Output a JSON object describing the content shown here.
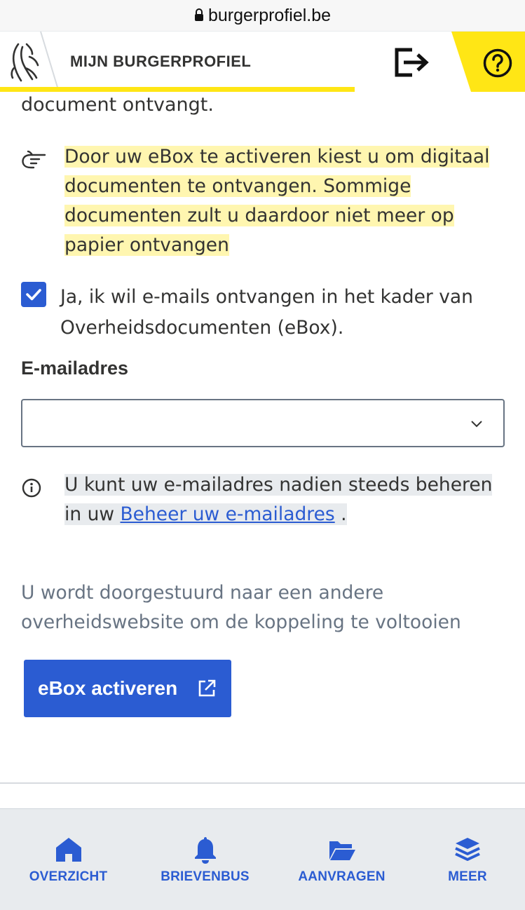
{
  "browser": {
    "url": "burgerprofiel.be"
  },
  "header": {
    "title": "MIJN BURGERPROFIEL",
    "accent_color": "#ffe615"
  },
  "content": {
    "paragraph_end": "document ontvangt.",
    "callout_text": "Door uw eBox te activeren kiest u om digitaal documenten te ontvangen. Sommige documenten zult u daardoor niet meer op papier ontvangen",
    "checkbox": {
      "checked": true,
      "label": "Ja, ik wil e-mails ontvangen in het kader van Overheidsdocumenten (eBox)."
    },
    "email": {
      "label": "E-mailadres",
      "value": ""
    },
    "info": {
      "text_before": "U kunt uw e-mailadres nadien steeds beheren in uw ",
      "link": "Beheer uw e-mailadres",
      "text_after": " ."
    },
    "redirect_text": "U wordt doorgestuurd naar een andere overheidswebsite om de koppeling te voltooien",
    "activate_button": "eBox activeren"
  },
  "tabbar": {
    "items": [
      {
        "label": "OVERZICHT",
        "icon": "home-icon"
      },
      {
        "label": "BRIEVENBUS",
        "icon": "bell-icon"
      },
      {
        "label": "AANVRAGEN",
        "icon": "folder-icon"
      },
      {
        "label": "MEER",
        "icon": "layers-icon"
      }
    ]
  },
  "colors": {
    "primary": "#2b5cd2",
    "highlight_yellow": "#fff6b0",
    "highlight_grey": "#e8ebee",
    "text": "#333332",
    "muted": "#687483"
  }
}
